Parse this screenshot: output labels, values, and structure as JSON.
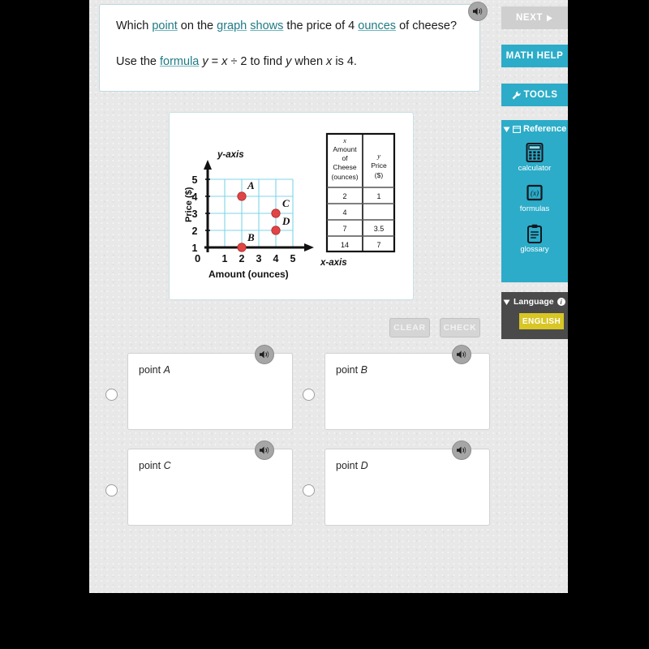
{
  "question": {
    "line1_parts": [
      {
        "t": "Which ",
        "v": false
      },
      {
        "t": "point",
        "v": true
      },
      {
        "t": " on the ",
        "v": false
      },
      {
        "t": "graph",
        "v": true
      },
      {
        "t": " ",
        "v": false
      },
      {
        "t": "shows",
        "v": true
      },
      {
        "t": " the price of 4 ",
        "v": false
      },
      {
        "t": "ounces",
        "v": true
      },
      {
        "t": " of cheese?",
        "v": false
      }
    ],
    "line1_plain": "Which point on the graph shows the price of 4 ounces of cheese?",
    "line2_plain": "Use the formula y = x ÷ 2 to find y when x is 4.",
    "line2_prefix": "Use the ",
    "line2_vocab": "formula",
    "line2_formula_y1": "y",
    "line2_eq": " = ",
    "line2_x": "x",
    "line2_div": " ÷ 2 to find ",
    "line2_y2": "y",
    "line2_when": " when ",
    "line2_x2": "x",
    "line2_end": " is 4."
  },
  "speaker_icon": "speaker-icon",
  "graph": {
    "title_y": "y-axis",
    "title_x": "x-axis",
    "ylabel": "Price ($)",
    "xlabel": "Amount (ounces)",
    "origin_label": "0",
    "y_ticks": [
      "1",
      "2",
      "3",
      "4",
      "5"
    ],
    "x_ticks": [
      "1",
      "2",
      "3",
      "4",
      "5"
    ],
    "grid_color": "#7fd4e8",
    "point_color": "#e04646"
  },
  "chart_data": {
    "type": "scatter",
    "title": "",
    "xlabel": "Amount (ounces)",
    "ylabel": "Price ($)",
    "xlim": [
      0,
      5.5
    ],
    "ylim": [
      0,
      5.5
    ],
    "xticks": [
      1,
      2,
      3,
      4,
      5
    ],
    "yticks": [
      1,
      2,
      3,
      4,
      5
    ],
    "grid": true,
    "points": [
      {
        "label": "A",
        "x": 2,
        "y": 4
      },
      {
        "label": "B",
        "x": 2,
        "y": 1
      },
      {
        "label": "C",
        "x": 4,
        "y": 3
      },
      {
        "label": "D",
        "x": 4,
        "y": 2
      }
    ],
    "table": {
      "headers": [
        "x\nAmount of Cheese (ounces)",
        "y\nPrice ($)"
      ],
      "header_col1_lines": [
        "x",
        "Amount",
        "of",
        "Cheese",
        "(ounces)"
      ],
      "header_col2_lines": [
        "y",
        "Price",
        "($)"
      ],
      "rows": [
        [
          "2",
          "1"
        ],
        [
          "4",
          ""
        ],
        [
          "7",
          "3.5"
        ],
        [
          "14",
          "7"
        ]
      ]
    }
  },
  "sidebar": {
    "next_label": "NEXT",
    "next_icon": "play-triangle-icon",
    "math_help_label": "MATH HELP",
    "tools_label": "TOOLS",
    "tools_icon": "wrench-icon",
    "reference": {
      "header_label": "Reference",
      "collapse_icon": "triangle-down-icon",
      "window_icon": "window-icon",
      "items": [
        {
          "label": "calculator",
          "icon": "calculator-icon"
        },
        {
          "label": "formulas",
          "icon": "formulas-icon"
        },
        {
          "label": "glossary",
          "icon": "clipboard-icon"
        }
      ]
    },
    "language": {
      "header_label": "Language",
      "collapse_icon": "triangle-down-icon",
      "info_icon": "info-icon",
      "info_glyph": "i",
      "selected": "ENGLISH"
    }
  },
  "actions": {
    "clear_label": "CLEAR",
    "check_label": "CHECK"
  },
  "options": [
    {
      "prefix": "point ",
      "letter": "A"
    },
    {
      "prefix": "point ",
      "letter": "B"
    },
    {
      "prefix": "point ",
      "letter": "C"
    },
    {
      "prefix": "point ",
      "letter": "D"
    }
  ],
  "colors": {
    "teal": "#2cacc8",
    "yellow": "#d8c626",
    "vocab_link": "#1f7a85",
    "page_bg": "#e8e8e8"
  }
}
